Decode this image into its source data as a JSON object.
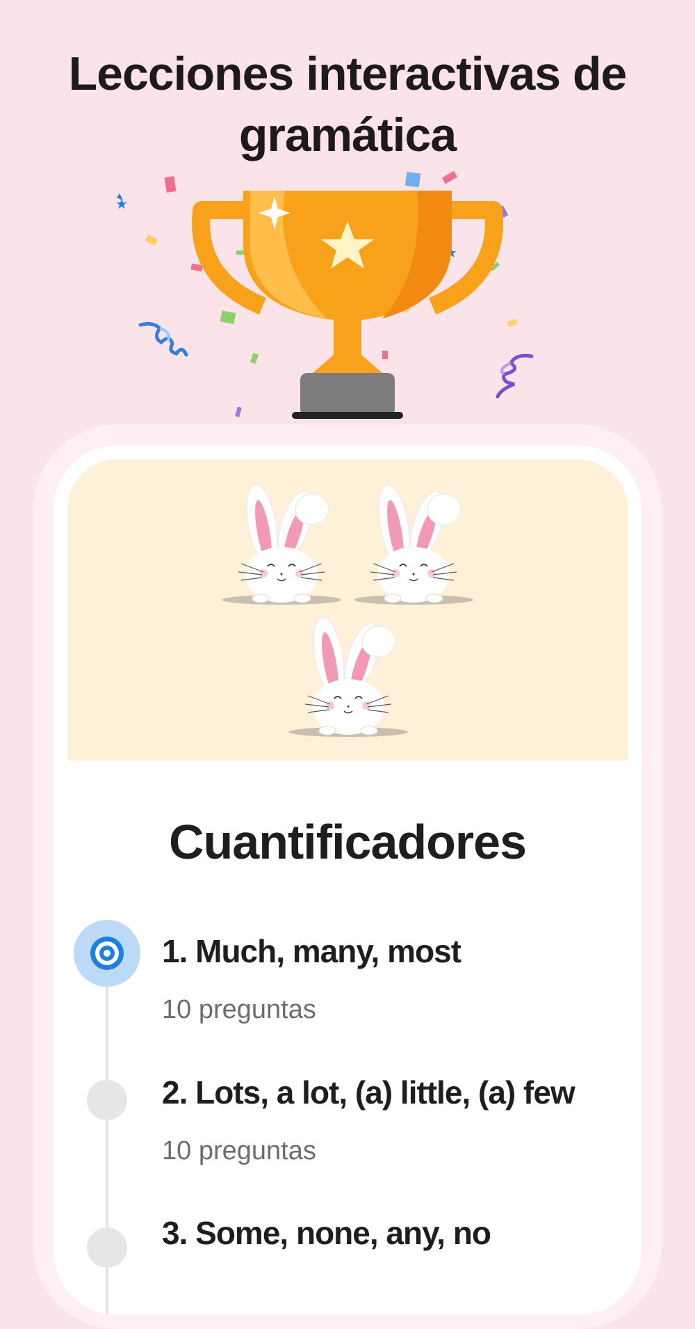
{
  "header": {
    "headline": "Lecciones interactivas de gramática"
  },
  "lesson": {
    "title": "Cuantificadores",
    "items": [
      {
        "title": "1. Much, many, most",
        "subtitle": "10 preguntas",
        "state": "current"
      },
      {
        "title": "2. Lots, a lot, (a) little, (a) few",
        "subtitle": "10 preguntas",
        "state": "locked"
      },
      {
        "title": "3. Some, none, any, no",
        "subtitle": "",
        "state": "locked"
      }
    ]
  },
  "colors": {
    "background": "#fbe3ea",
    "banner": "#fff0d8",
    "accent_blue": "#1e7fe0",
    "trophy_gold": "#f7a21a"
  },
  "icons": {
    "trophy": "trophy-icon",
    "current_lesson": "target-icon",
    "bunny": "bunny-illustration"
  }
}
